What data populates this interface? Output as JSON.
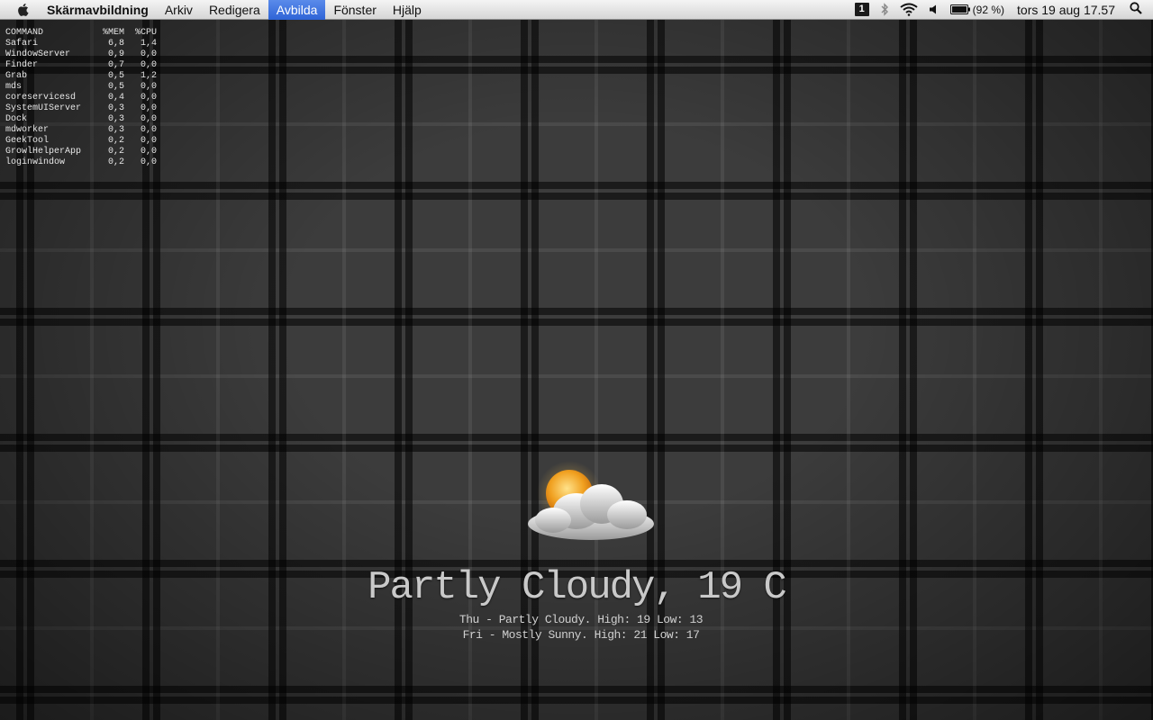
{
  "menubar": {
    "app_name": "Skärmavbildning",
    "items": [
      {
        "label": "Arkiv"
      },
      {
        "label": "Redigera"
      },
      {
        "label": "Avbilda",
        "active": true
      },
      {
        "label": "Fönster"
      },
      {
        "label": "Hjälp"
      }
    ],
    "status": {
      "spaces_number": "1",
      "battery_percent": "(92 %)",
      "clock": "tors 19 aug  17.57",
      "icons": [
        "spaces-icon",
        "bluetooth-icon",
        "wifi-icon",
        "volume-icon",
        "battery-icon",
        "spotlight-icon"
      ]
    },
    "accent_color": "#3b6fe0"
  },
  "processes": {
    "headers": {
      "command": "COMMAND",
      "mem": "%MEM",
      "cpu": "%CPU"
    },
    "rows": [
      {
        "command": "Safari",
        "mem": "6,8",
        "cpu": "1,4"
      },
      {
        "command": "WindowServer",
        "mem": "0,9",
        "cpu": "0,0"
      },
      {
        "command": "Finder",
        "mem": "0,7",
        "cpu": "0,0"
      },
      {
        "command": "Grab",
        "mem": "0,5",
        "cpu": "1,2"
      },
      {
        "command": "mds",
        "mem": "0,5",
        "cpu": "0,0"
      },
      {
        "command": "coreservicesd",
        "mem": "0,4",
        "cpu": "0,0"
      },
      {
        "command": "SystemUIServer",
        "mem": "0,3",
        "cpu": "0,0"
      },
      {
        "command": "Dock",
        "mem": "0,3",
        "cpu": "0,0"
      },
      {
        "command": "mdworker",
        "mem": "0,3",
        "cpu": "0,0"
      },
      {
        "command": "GeekTool",
        "mem": "0,2",
        "cpu": "0,0"
      },
      {
        "command": "GrowlHelperApp",
        "mem": "0,2",
        "cpu": "0,0"
      },
      {
        "command": "loginwindow",
        "mem": "0,2",
        "cpu": "0,0"
      }
    ]
  },
  "weather": {
    "icon": "partly-cloudy-icon",
    "current": "Partly Cloudy, 19 C",
    "forecast": [
      "Thu - Partly Cloudy. High: 19 Low: 13",
      "Fri - Mostly Sunny. High: 21 Low: 17"
    ]
  }
}
